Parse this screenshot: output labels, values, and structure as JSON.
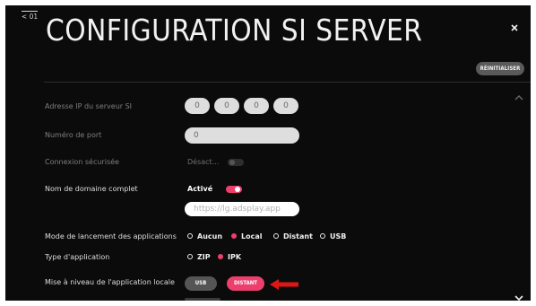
{
  "header": {
    "back_label": "< 01",
    "title": "CONFIGURATION SI SERVER",
    "close_icon": "close-icon",
    "reset_label": "RÉINITIALISER"
  },
  "colors": {
    "background": "#0b0b0b",
    "accent": "#ec3f6e",
    "disabled_text": "#7f7f7f",
    "pill_bg": "#dedede"
  },
  "settings": {
    "ip": {
      "label": "Adresse IP du serveur SI",
      "octets": [
        "0",
        "0",
        "0",
        "0"
      ],
      "enabled": false
    },
    "port": {
      "label": "Numéro de port",
      "value": "0",
      "enabled": false
    },
    "secure": {
      "label": "Connexion sécurisée",
      "state": "Désact...",
      "enabled": false,
      "on": false
    },
    "fqdn": {
      "label": "Nom de domaine complet",
      "state": "Activé",
      "on": true,
      "placeholder": "https://lg.adsplay.app"
    },
    "launch_mode": {
      "label": "Mode de lancement des applications",
      "options": [
        "Aucun",
        "Local",
        "Distant",
        "USB"
      ],
      "selected": "Local"
    },
    "app_type": {
      "label": "Type d'application",
      "options": [
        "ZIP",
        "IPK"
      ],
      "selected": "IPK"
    },
    "app_upgrade": {
      "label": "Mise à niveau de l'application locale",
      "options": [
        "USB",
        "DISTANT"
      ],
      "selected": "DISTANT"
    }
  }
}
